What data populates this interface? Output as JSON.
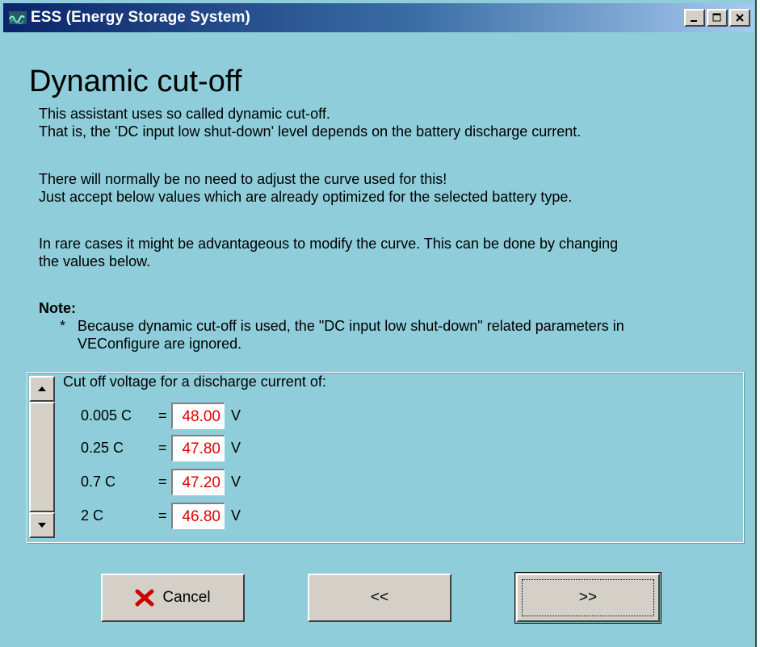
{
  "window": {
    "title": "ESS (Energy Storage System)",
    "icon": "victron-wave-icon",
    "controls": [
      "minimize-icon",
      "maximize-icon",
      "close-icon"
    ]
  },
  "page": {
    "heading": "Dynamic cut-off",
    "para1_line1": "This assistant uses so called dynamic cut-off.",
    "para1_line2": "That is, the  'DC input low shut-down' level depends on the battery discharge current.",
    "para2_line1": "There will normally be no need to adjust the curve used for this!",
    "para2_line2": "Just accept below values which are already optimized for the selected battery type.",
    "para3_line1": "In rare cases it might be advantageous to modify the curve. This can be done by changing",
    "para3_line2": "the values below.",
    "note_label": "Note:",
    "note_bullet": "*",
    "note_line1": "Because dynamic cut-off is used, the \"DC input low shut-down\" related parameters in",
    "note_line2": "VEConfigure are ignored."
  },
  "cutoff": {
    "caption": "Cut off voltage for a discharge current of:",
    "equals": "=",
    "unit": "V",
    "rows": [
      {
        "label": "0.005 C",
        "value": "48.00"
      },
      {
        "label": "0.25 C",
        "value": "47.80"
      },
      {
        "label": "0.7 C",
        "value": "47.20"
      },
      {
        "label": "2 C",
        "value": "46.80"
      }
    ],
    "value_color": "#e00000"
  },
  "buttons": {
    "cancel": "Cancel",
    "back": "<<",
    "next": ">>"
  },
  "colors": {
    "background": "#8ecdd9",
    "cancel_icon": "#cc0000"
  }
}
